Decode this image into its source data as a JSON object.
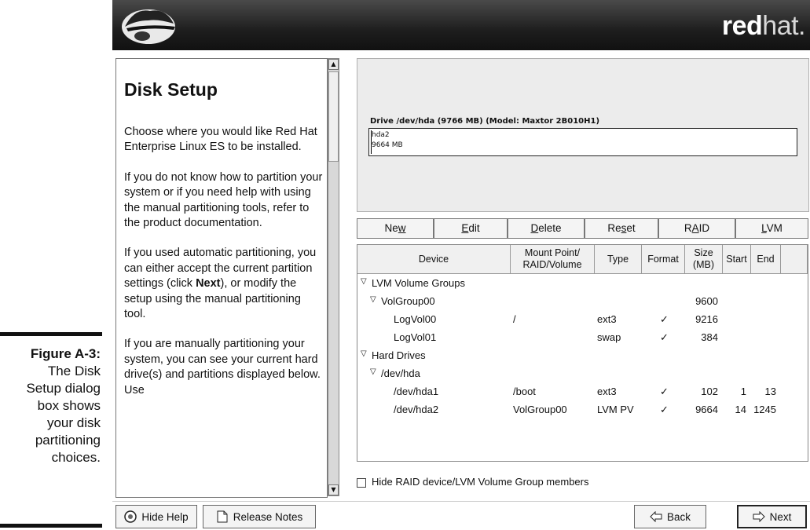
{
  "caption": {
    "figure_label": "Figure A-3:",
    "lines": [
      "The Disk",
      "Setup dialog",
      "box shows",
      "your disk",
      "partitioning",
      "choices."
    ]
  },
  "banner": {
    "brand_bold": "red",
    "brand_light": "hat."
  },
  "help": {
    "title": "Disk Setup",
    "paragraphs": [
      "Choose where you would like Red Hat Enterprise Linux ES to be installed.",
      "If you do not know how to partition your system or if you need help with using the manual partitioning tools, refer to the product documentation.",
      "If you used automatic partitioning, you can either accept the current partition settings (click Next), or modify the setup using the manual partitioning tool.",
      "If you are manually partitioning your system, you can see your current hard drive(s) and partitions displayed below. Use"
    ]
  },
  "drive": {
    "label": "Drive /dev/hda (9766 MB) (Model: Maxtor 2B010H1)",
    "partition_name": "hda2",
    "partition_size": "9664 MB"
  },
  "toolbar": {
    "new": "New",
    "edit": "Edit",
    "delete": "Delete",
    "reset": "Reset",
    "raid": "RAID",
    "lvm": "LVM"
  },
  "table": {
    "headers": {
      "device": "Device",
      "mount": "Mount Point/ RAID/Volume",
      "type": "Type",
      "format": "Format",
      "size": "Size (MB)",
      "start": "Start",
      "end": "End"
    },
    "rows": [
      {
        "device": "LVM Volume Groups",
        "mount": "",
        "type": "",
        "format": "",
        "size": "",
        "start": "",
        "end": ""
      },
      {
        "device": "VolGroup00",
        "mount": "",
        "type": "",
        "format": "",
        "size": "9600",
        "start": "",
        "end": ""
      },
      {
        "device": "LogVol00",
        "mount": "/",
        "type": "ext3",
        "format": "✓",
        "size": "9216",
        "start": "",
        "end": ""
      },
      {
        "device": "LogVol01",
        "mount": "",
        "type": "swap",
        "format": "✓",
        "size": "384",
        "start": "",
        "end": ""
      },
      {
        "device": "Hard Drives",
        "mount": "",
        "type": "",
        "format": "",
        "size": "",
        "start": "",
        "end": ""
      },
      {
        "device": "/dev/hda",
        "mount": "",
        "type": "",
        "format": "",
        "size": "",
        "start": "",
        "end": ""
      },
      {
        "device": "/dev/hda1",
        "mount": "/boot",
        "type": "ext3",
        "format": "✓",
        "size": "102",
        "start": "1",
        "end": "13"
      },
      {
        "device": "/dev/hda2",
        "mount": "VolGroup00",
        "type": "LVM PV",
        "format": "✓",
        "size": "9664",
        "start": "14",
        "end": "1245"
      }
    ]
  },
  "hide_members_label": "Hide RAID device/LVM Volume Group members",
  "bottom": {
    "hide_help": "Hide Help",
    "release_notes": "Release Notes",
    "back": "Back",
    "next": "Next"
  }
}
